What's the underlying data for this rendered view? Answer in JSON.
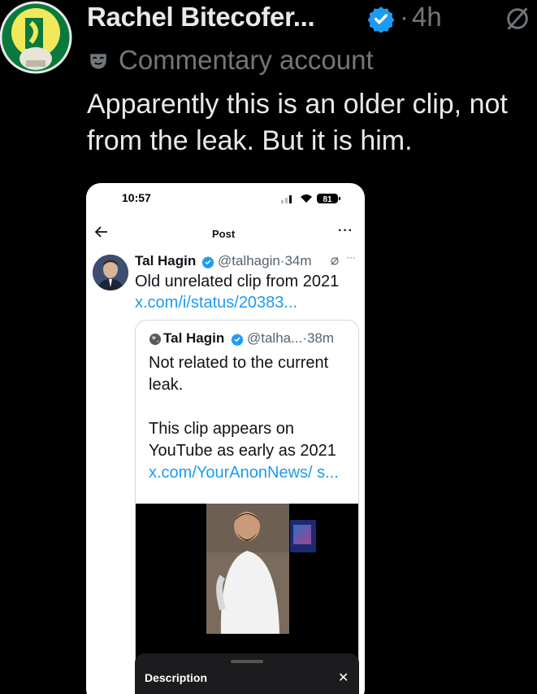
{
  "author": {
    "name": "Rachel Bitecofer...",
    "time": "4h",
    "label": "Commentary account"
  },
  "tweet": {
    "text": "Apparently this is an older clip, not from the leak. But it is him."
  },
  "screenshot": {
    "status_time": "10:57",
    "battery": "81",
    "header_title": "Post",
    "header_more": "···",
    "post": {
      "name": "Tal Hagin",
      "handle_time": "@talhagin·34m",
      "more": "···",
      "text": "Old unrelated clip from 2021",
      "link": "x.com/i/status/20383..."
    },
    "quote": {
      "name": "Tal Hagin",
      "handle_time": "@talha...·38m",
      "text1": "Not related to the current leak.",
      "text2": "This clip appears on YouTube as early as 2021",
      "link": "x.com/YourAnonNews/ s..."
    },
    "sheet": {
      "label": "Description",
      "close": "✕"
    }
  },
  "colors": {
    "background": "#000000",
    "text_primary": "#e7e9ea",
    "text_secondary": "#71767b",
    "verified_blue": "#1d9bf0",
    "link_blue": "#1d9bf0"
  },
  "icons": [
    "avatar",
    "verified-badge-icon",
    "grok-icon",
    "commentary-mask-icon",
    "back-arrow-icon",
    "more-icon",
    "globe-icon",
    "close-icon"
  ]
}
